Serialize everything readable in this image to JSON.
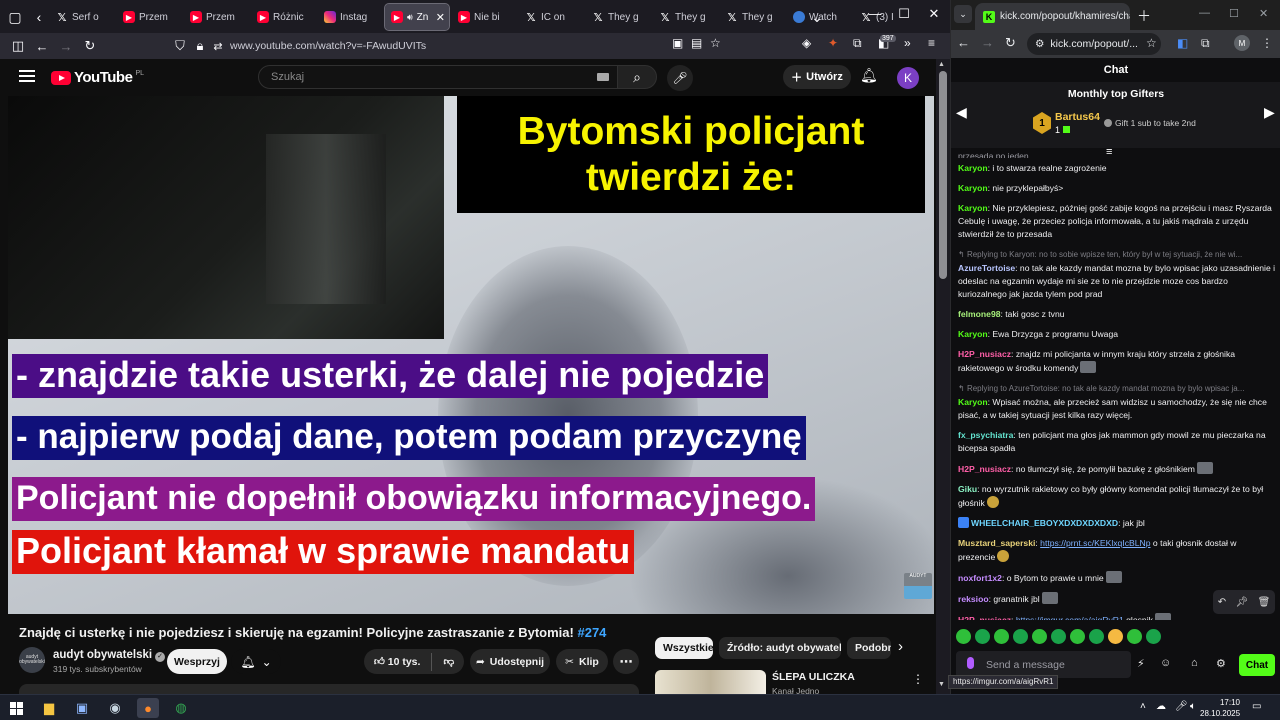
{
  "firefox": {
    "tabs": [
      {
        "title": "Serf o",
        "icon": "x"
      },
      {
        "title": "Przem",
        "icon": "youtube"
      },
      {
        "title": "Przem",
        "icon": "youtube"
      },
      {
        "title": "Różnic",
        "icon": "youtube"
      },
      {
        "title": "Instag",
        "icon": "instagram"
      },
      {
        "title": "Zn",
        "icon": "youtube"
      },
      {
        "title": "Nie bi",
        "icon": "youtube"
      },
      {
        "title": "IC on",
        "icon": "x"
      },
      {
        "title": "They g",
        "icon": "x"
      },
      {
        "title": "They g",
        "icon": "x"
      },
      {
        "title": "They g",
        "icon": "x"
      },
      {
        "title": "Watch",
        "icon": "edge"
      },
      {
        "title": "(3) I",
        "icon": "x"
      }
    ],
    "url": "www.youtube.com/watch?v=-FAwudUVITs",
    "extension_badge": "397"
  },
  "youtube": {
    "logo_text": "YouTube",
    "country": "PL",
    "search_placeholder": "Szukaj",
    "create_label": "Utwórz",
    "avatar_letter": "K",
    "video": {
      "title_line1": "Bytomski policjant",
      "title_line2": "twierdzi że:",
      "bar1": "- znajdzie takie usterki, że dalej nie pojedzie",
      "bar2": "- najpierw podaj dane, potem podam przyczynę",
      "bar3": "Policjant nie dopełnił obowiązku informacyjnego.",
      "bar4": "Policjant kłamał w sprawie mandatu",
      "corner_logo_text": "AUDYT"
    },
    "video_title": "Znajdę ci usterkę i nie pojedziesz i skieruję na egzamin! Policyjne zastraszanie z Bytomia!",
    "video_hashtag": "#274",
    "channel": {
      "name": "audyt obywatelski",
      "subscribers": "319 tys. subskrybentów",
      "avatar_text": "audyt obywatelski"
    },
    "support_label": "Wesprzyj",
    "likes": "10 tys.",
    "share_label": "Udostępnij",
    "clip_label": "Klip",
    "chips": [
      "Wszystkie",
      "Źródło: audyt obywatelski",
      "Podobne"
    ],
    "recommended": {
      "title": "ŚLEPA ULICZKA",
      "channel": "Kanał Jedno"
    }
  },
  "chrome": {
    "tab_title": "kick.com/popout/khamires/chat",
    "omnibox": "kick.com/popout/...",
    "profile_letter": "M"
  },
  "kick_chat": {
    "header": "Chat",
    "gifters_title": "Monthly top Gifters",
    "top_gifter": {
      "rank": "1",
      "name": "Bartus64",
      "count": "1"
    },
    "gifter_cta": "Gift 1 sub to take 2nd",
    "partial_top": "przesada po jeden",
    "messages": [
      {
        "user": "Karyon",
        "color": "c-green",
        "text": "i to stwarza realne zagrożenie"
      },
      {
        "user": "Karyon",
        "color": "c-green",
        "text": "nie przyklepałbyś>"
      },
      {
        "user": "Karyon",
        "color": "c-green",
        "text": "Nie przyklepiesz, później gość zabije kogoś na przejściu i masz Ryszarda Cebulę i uwagę, że przeciez policja informowała, a tu jakiś mądrala z urzędu stwierdził że to przesada"
      },
      {
        "reply": "Replying to Karyon: no to sobie wpisze ten, który był w tej sytuacji, że nie wi...",
        "user": "AzureTortoise",
        "color": "c-azure",
        "text": "no tak ale kazdy mandat mozna by bylo wpisac jako uzasadnienie i odeslac na egzamin wydaje mi sie ze to nie przejdzie moze cos bardzo kuriozalnego jak jazda tylem pod prad"
      },
      {
        "user": "felmone98",
        "color": "c-lime",
        "text": "taki gosc z tvnu"
      },
      {
        "user": "Karyon",
        "color": "c-green",
        "text": "Ewa Drzyzga z programu Uwaga"
      },
      {
        "user": "H2P_nusiacz",
        "color": "c-pink",
        "text": "znajdz mi policjanta w innym kraju który strzela z głośnika rakietowego w środku komendy",
        "emote": true
      },
      {
        "reply": "Replying to AzureTortoise: no tak ale kazdy mandat mozna by bylo wpisac ja...",
        "user": "Karyon",
        "color": "c-green",
        "text": "Wpisać można, ale przecież sam widzisz u samochodzy, że się nie chce pisać, a w takiej sytuacji jest kilka razy więcej."
      },
      {
        "user": "fx_psychiatra",
        "color": "c-teal",
        "text": "ten policjant ma głos jak mammon gdy mowil ze mu pieczarka na bicepsa spadła"
      },
      {
        "user": "H2P_nusiacz",
        "color": "c-pink",
        "text": "no tłumczył się, że pomylił bazukę z głośnikiem",
        "emote": true
      },
      {
        "user": "Giku",
        "color": "c-mint",
        "text": "no wyrzutnik rakietowy co były główny komendat policji tłumaczył że to był głośnik",
        "emote": "y"
      },
      {
        "user": "WHEELCHAIR_EBOYXDXDXDXDXD",
        "color": "c-cyanish",
        "text": "jak jbl",
        "badge": true
      },
      {
        "user": "Musztard_saperski",
        "color": "c-tan",
        "link": "https://prnt.sc/KEKlxqIcBLNp",
        "text": "o taki głosnik dostał w prezencie",
        "emote": "y"
      },
      {
        "user": "noxfort1x2",
        "color": "c-violet",
        "text": "o Bytom to prawie u mnie",
        "emote": true
      },
      {
        "user": "reksioo",
        "color": "c-violet",
        "text": "granatnik jbl",
        "emote": true
      },
      {
        "user": "H2P_nusiacz",
        "color": "c-pink",
        "link": "https://imgur.com/a/aigRvR1",
        "text": "glosnik",
        "emote": true
      }
    ],
    "input_placeholder": "Send a message",
    "chat_button": "Chat",
    "hover_url": "https://imgur.com/a/aigRvR1"
  },
  "taskbar": {
    "time": "17:10",
    "date": "28.10.2025"
  }
}
